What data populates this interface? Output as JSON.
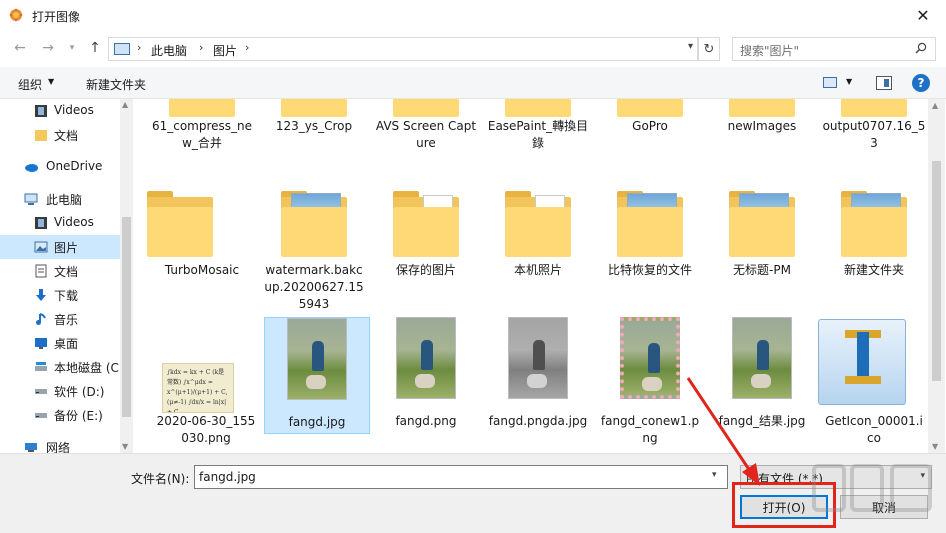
{
  "window": {
    "title": "打开图像",
    "close_glyph": "✕"
  },
  "address": {
    "crumbs": [
      "此电脑",
      "图片"
    ],
    "search_placeholder": "搜索\"图片\""
  },
  "toolbar": {
    "organize_label": "组织",
    "new_folder_label": "新建文件夹"
  },
  "nav": {
    "items": [
      {
        "label": "Videos",
        "icon": "video-icon",
        "indent": true
      },
      {
        "label": "文档",
        "icon": "document-icon",
        "indent": true
      },
      {
        "label": "OneDrive",
        "icon": "onedrive-icon",
        "indent": false
      },
      {
        "label": "此电脑",
        "icon": "computer-icon",
        "indent": false
      },
      {
        "label": "Videos",
        "icon": "video-icon",
        "indent": true
      },
      {
        "label": "图片",
        "icon": "pictures-icon",
        "indent": true,
        "selected": true
      },
      {
        "label": "文档",
        "icon": "document-icon",
        "indent": true
      },
      {
        "label": "下载",
        "icon": "download-icon",
        "indent": true
      },
      {
        "label": "音乐",
        "icon": "music-icon",
        "indent": true
      },
      {
        "label": "桌面",
        "icon": "desktop-icon",
        "indent": true
      },
      {
        "label": "本地磁盘 (C",
        "icon": "drive-icon",
        "indent": true
      },
      {
        "label": "软件 (D:)",
        "icon": "drive-icon",
        "indent": true
      },
      {
        "label": "备份 (E:)",
        "icon": "drive-icon",
        "indent": true
      },
      {
        "label": "网络",
        "icon": "network-icon",
        "indent": false
      }
    ]
  },
  "files": {
    "row1": [
      {
        "name": "61_compress_new_合并",
        "kind": "folder-photo"
      },
      {
        "name": "123_ys_Crop",
        "kind": "folder-photo"
      },
      {
        "name": "AVS Screen Capture",
        "kind": "folder"
      },
      {
        "name": "EasePaint_轉換目錄",
        "kind": "folder-photo"
      },
      {
        "name": "GoPro",
        "kind": "folder"
      },
      {
        "name": "newImages",
        "kind": "folder-photo"
      },
      {
        "name": "output0707.16_53",
        "kind": "folder-photo"
      }
    ],
    "row2": [
      {
        "name": "TurboMosaic",
        "kind": "folder"
      },
      {
        "name": "watermark.bakcup.20200627.155943",
        "kind": "folder-photo"
      },
      {
        "name": "保存的图片",
        "kind": "folder-doc"
      },
      {
        "name": "本机照片",
        "kind": "folder-doc"
      },
      {
        "name": "比特恢复的文件",
        "kind": "folder-photo"
      },
      {
        "name": "无标题-PM",
        "kind": "folder-photo"
      },
      {
        "name": "新建文件夹",
        "kind": "folder-photo"
      }
    ],
    "row3": [
      {
        "name": "2020-06-30_155030.png",
        "kind": "doc-image",
        "formula": "∫kdx = kx + C (k是常数)  ∫x^μdx = x^(μ+1)/(μ+1) + C, (μ≠-1)  ∫dx/x = ln|x| + C"
      },
      {
        "name": "fangd.jpg",
        "kind": "photo",
        "selected": true
      },
      {
        "name": "fangd.png",
        "kind": "photo"
      },
      {
        "name": "fangd.pngda.jpg",
        "kind": "photo-gray"
      },
      {
        "name": "fangd_conew1.png",
        "kind": "photo-frame"
      },
      {
        "name": "fangd_结果.jpg",
        "kind": "photo"
      },
      {
        "name": "GetIcon_00001.ico",
        "kind": "app-icon"
      }
    ]
  },
  "bottom": {
    "filename_label": "文件名(N):",
    "filename_value": "fangd.jpg",
    "filetype_value": "所有文件 (*.*)",
    "open_label": "打开(O)",
    "cancel_label": "取消"
  },
  "colors": {
    "accent": "#0078d7",
    "selection": "#cce8ff",
    "annotation": "#e0251b"
  }
}
